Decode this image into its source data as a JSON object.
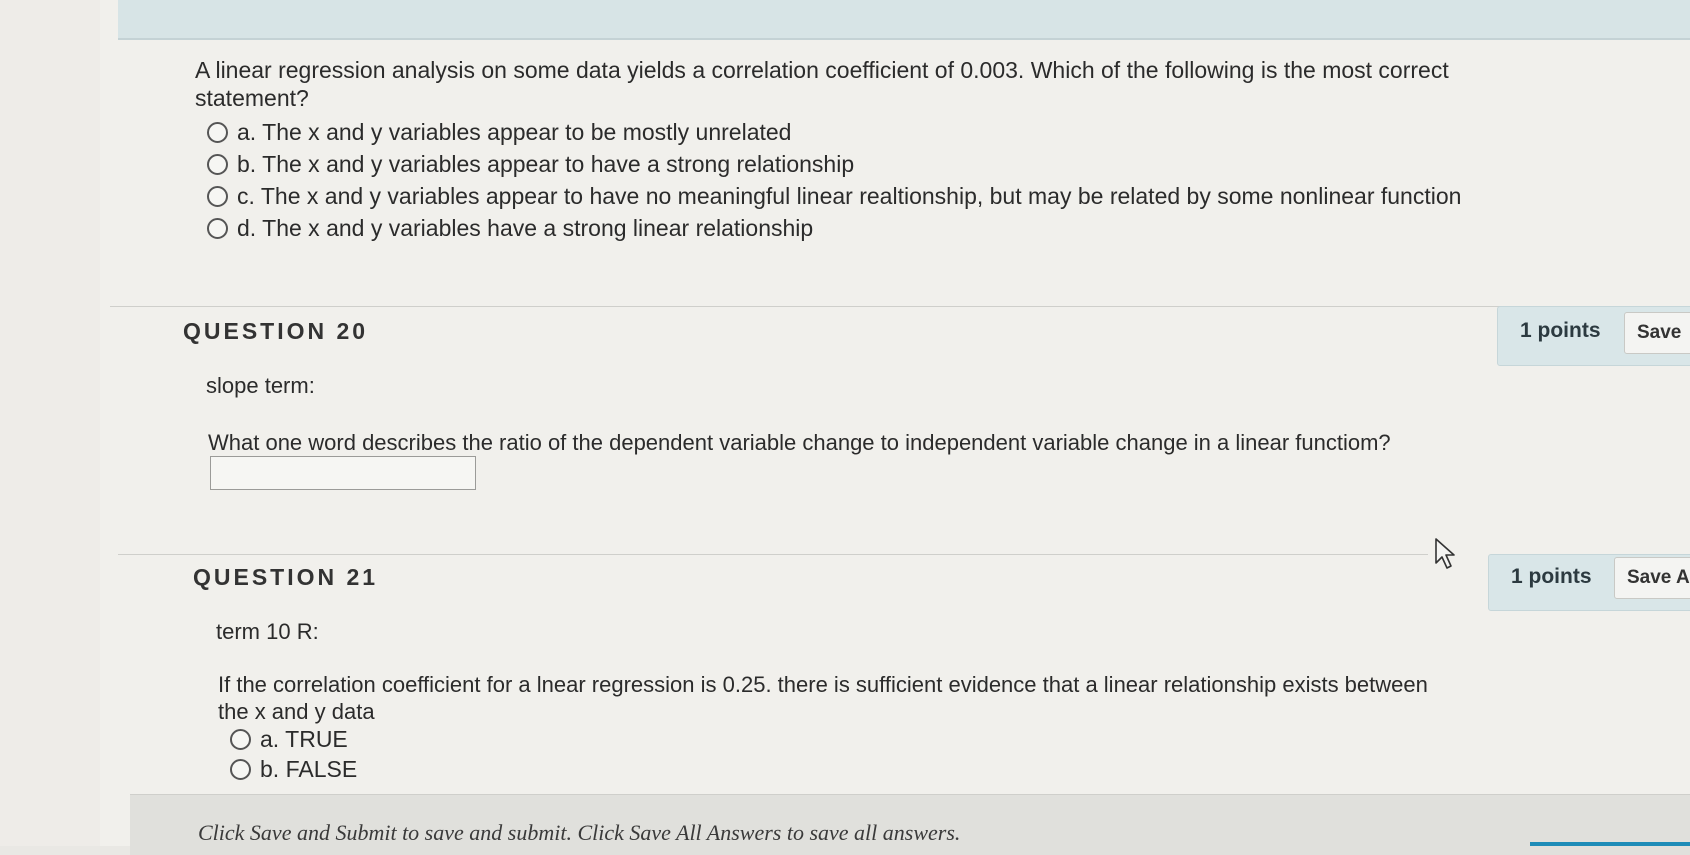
{
  "q19": {
    "prompt": "A linear regression analysis on some data yields a correlation coefficient of 0.003. Which of the following is the most correct statement?",
    "choices": [
      "a. The x and y variables appear to be mostly unrelated",
      "b. The x and y variables appear to have a strong relationship",
      "c. The x and y variables appear to have no meaningful linear realtionship, but may be related by some nonlinear function",
      "d. The x and y variables have a strong linear relationship"
    ]
  },
  "q20": {
    "header": "QUESTION 20",
    "points": "1 points",
    "save_label": "Save",
    "title": "slope term:",
    "question": "What one word describes the ratio of the dependent variable change to independent variable change in a linear functiom?",
    "answer_value": ""
  },
  "q21": {
    "header": "QUESTION 21",
    "points": "1 points",
    "save_label": "Save A",
    "title": "term 10 R:",
    "question": "If the correlation coefficient for a lnear regression is 0.25. there is sufficient evidence that a linear relationship exists between the x and y data",
    "choices": [
      "a. TRUE",
      "b. FALSE"
    ]
  },
  "footer": {
    "text": "Click Save and Submit to save and submit. Click Save All Answers to save all answers."
  },
  "colors": {
    "header_bar": "#d7e4e6",
    "points_box": "#d9e6e8",
    "accent": "#1e8cb8"
  }
}
